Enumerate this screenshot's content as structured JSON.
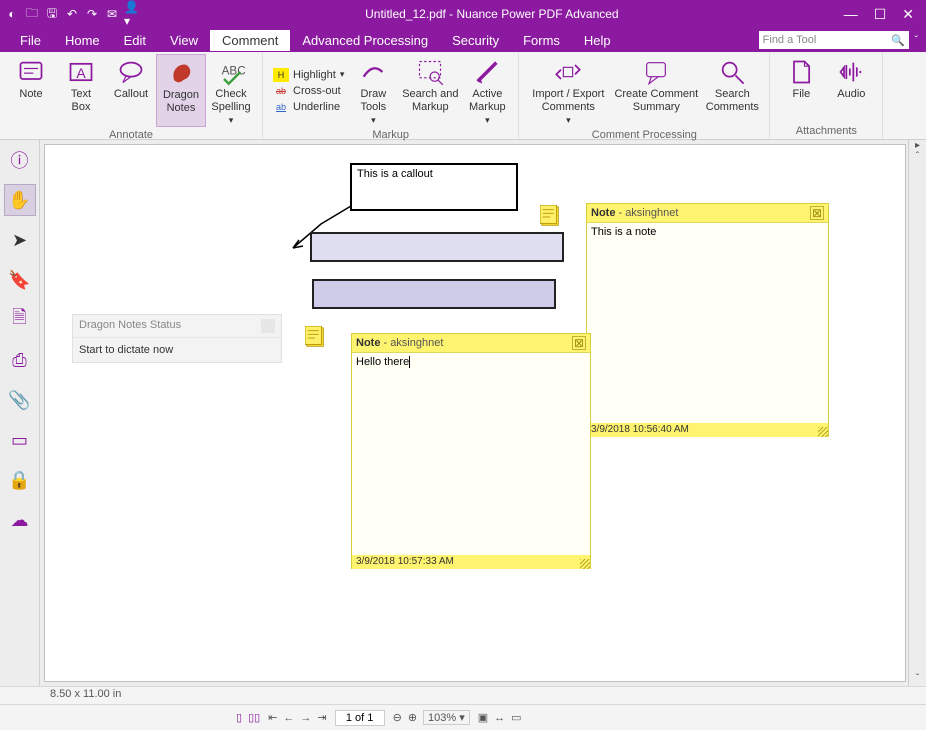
{
  "title": "Untitled_12.pdf - Nuance Power PDF Advanced",
  "menu": {
    "file": "File",
    "home": "Home",
    "edit": "Edit",
    "view": "View",
    "comment": "Comment",
    "adv": "Advanced Processing",
    "security": "Security",
    "forms": "Forms",
    "help": "Help"
  },
  "findtool": {
    "placeholder": "Find a Tool"
  },
  "ribbon": {
    "annotate": {
      "label": "Annotate",
      "note": "Note",
      "textbox": "Text\nBox",
      "callout": "Callout",
      "dragon": "Dragon\nNotes",
      "spell": "Check\nSpelling"
    },
    "textmarkup": {
      "highlight": "Highlight",
      "crossout": "Cross-out",
      "underline": "Underline"
    },
    "markup": {
      "label": "Markup",
      "draw": "Draw\nTools",
      "search": "Search and\nMarkup",
      "active": "Active\nMarkup"
    },
    "cproc": {
      "label": "Comment Processing",
      "import": "Import / Export\nComments",
      "create": "Create Comment\nSummary",
      "searchc": "Search\nComments"
    },
    "attach": {
      "label": "Attachments",
      "file": "File",
      "audio": "Audio"
    }
  },
  "dragonpanel": {
    "title": "Dragon Notes Status",
    "body": "Start to dictate now"
  },
  "callout_text": "This is a callout",
  "note1": {
    "label": "Note",
    "author": "aksinghnet",
    "body": "This is a note",
    "time": "3/9/2018 10:56:40 AM"
  },
  "note2": {
    "label": "Note",
    "author": "aksinghnet",
    "body": "Hello there",
    "time": "3/9/2018 10:57:33 AM"
  },
  "status": {
    "dims": "8.50 x 11.00 in"
  },
  "bottombar": {
    "page": "1 of 1",
    "zoom": "103%"
  }
}
